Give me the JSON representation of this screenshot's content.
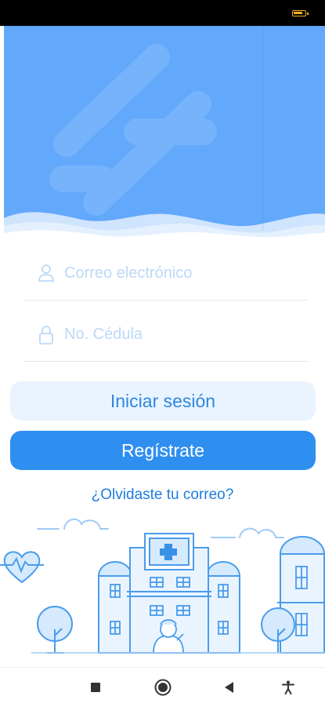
{
  "form": {
    "email": {
      "placeholder": "Correo electrónico",
      "value": "",
      "icon": "user-icon"
    },
    "id_number": {
      "placeholder": "No. Cédula",
      "value": "",
      "icon": "lock-icon"
    }
  },
  "actions": {
    "login_label": "Iniciar sesión",
    "register_label": "Regístrate",
    "forgot_label": "¿Olvidaste tu correo?"
  },
  "colors": {
    "hero_blue": "#62a8fb",
    "primary": "#2f8ff0",
    "primary_light": "#eaf4ff",
    "link": "#1f7ce0",
    "battery": "#f2b01e"
  },
  "nav_icons": [
    "recents-square-icon",
    "home-circle-icon",
    "back-triangle-icon",
    "accessibility-icon"
  ]
}
